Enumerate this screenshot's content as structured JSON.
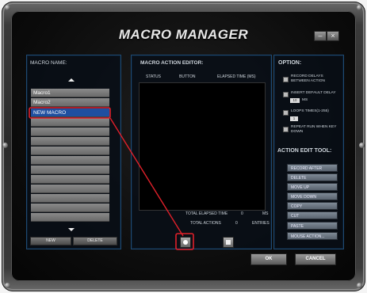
{
  "window": {
    "title": "MACRO MANAGER",
    "minimize_icon": "minimize-icon",
    "close_icon": "close-icon"
  },
  "macro_list": {
    "title": "MACRO NAME:",
    "items": [
      "Macro1",
      "Macro2",
      "NEW MACRO"
    ],
    "selected": "NEW MACRO",
    "new_label": "NEW",
    "delete_label": "DELETE"
  },
  "editor": {
    "title": "MACRO ACTION EDITOR:",
    "columns": [
      "STATUS",
      "BUTTON",
      "ELAPSED TIME (MS)"
    ],
    "total_elapsed_label": "TOTAL ELAPSED TIME",
    "total_elapsed_value": "0",
    "total_elapsed_unit": "MS",
    "total_actions_label": "TOTAL ACTIONS",
    "total_actions_value": "0",
    "total_actions_unit": "ENTRIES",
    "record_icon": "record-icon",
    "stop_icon": "stop-icon"
  },
  "option": {
    "title": "OPTION:",
    "record_delays": "RECORD DELAYS BETWEEN ACTION",
    "insert_default_delay": "INSERT DEFAULT DELAY",
    "delay_value": "10",
    "delay_unit": "MS",
    "loops_times": "LOOPS TIMES(1-255)",
    "loops_value": "1",
    "repeat_run": "REPEAT RUN WHEN KEY DOWN"
  },
  "tools": {
    "title": "ACTION EDIT TOOL:",
    "buttons": [
      "RECORD AFTER",
      "DELETE",
      "MOVE UP",
      "MOVE DOWN",
      "COPY",
      "CUT",
      "PASTE",
      "MOUSE ACTION..."
    ]
  },
  "footer": {
    "ok_label": "OK",
    "cancel_label": "CANCEL"
  },
  "colors": {
    "accent_blue": "#1f4fa0",
    "highlight_red": "#e0202a",
    "panel_border": "#1f4a73"
  }
}
